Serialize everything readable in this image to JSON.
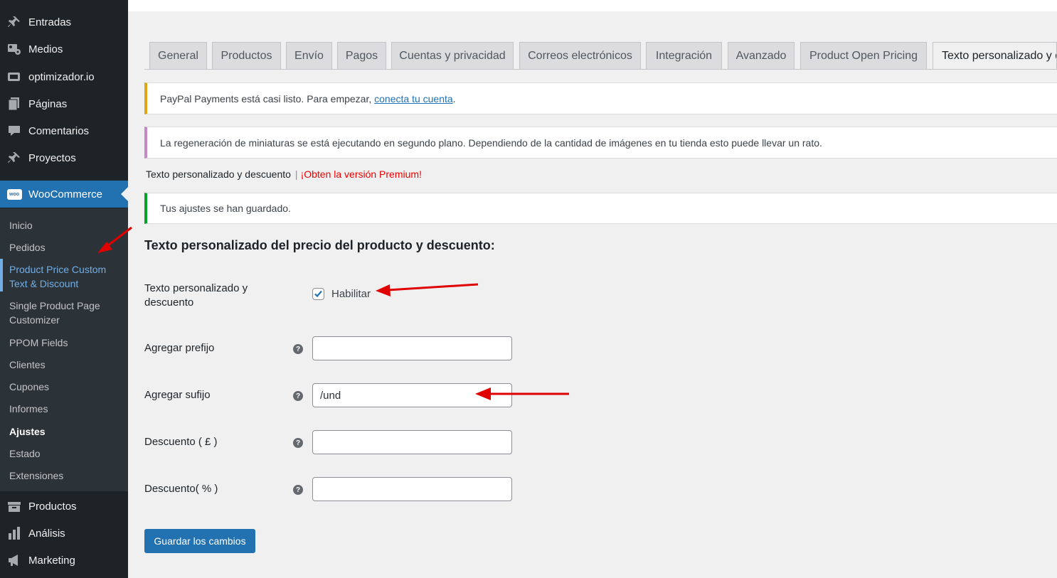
{
  "sidebar": {
    "menu_top": [
      {
        "label": "Entradas",
        "icon": "pin-icon"
      },
      {
        "label": "Medios",
        "icon": "media-icon"
      },
      {
        "label": "optimizador.io",
        "icon": "optimizer-icon"
      },
      {
        "label": "Páginas",
        "icon": "pages-icon"
      },
      {
        "label": "Comentarios",
        "icon": "comments-icon"
      },
      {
        "label": "Proyectos",
        "icon": "pin-icon"
      }
    ],
    "woocommerce": {
      "label": "WooCommerce",
      "icon": "woo-icon",
      "badge": "woo"
    },
    "submenu": [
      "Inicio",
      "Pedidos",
      "Product Price Custom Text & Discount",
      "Single Product Page Customizer",
      "PPOM Fields",
      "Clientes",
      "Cupones",
      "Informes",
      "Ajustes",
      "Estado",
      "Extensiones"
    ],
    "menu_bottom": [
      {
        "label": "Productos",
        "icon": "products-icon"
      },
      {
        "label": "Análisis",
        "icon": "analytics-icon"
      },
      {
        "label": "Marketing",
        "icon": "megaphone-icon"
      }
    ]
  },
  "tabs": [
    "General",
    "Productos",
    "Envío",
    "Pagos",
    "Cuentas y privacidad",
    "Correos electrónicos",
    "Integración",
    "Avanzado",
    "Product Open Pricing",
    "Texto personalizado y descuento"
  ],
  "notices": {
    "paypal_text": "PayPal Payments está casi listo. Para empezar,",
    "paypal_link": "conecta tu cuenta",
    "paypal_end": ".",
    "regen_text": "La regeneración de miniaturas se está ejecutando en segundo plano. Dependiendo de la cantidad de imágenes en tu tienda esto puede llevar un rato.",
    "saved_text": "Tus ajustes se han guardado."
  },
  "plugin_heading": {
    "title": "Texto personalizado y descuento",
    "separator": "|",
    "premium": "¡Obten la versión Premium!"
  },
  "form": {
    "section_title": "Texto personalizado del precio del producto y descuento:",
    "enable_label": "Texto personalizado y descuento",
    "enable_checkbox_label": "Habilitar",
    "enable_checked": true,
    "prefix_label": "Agregar prefijo",
    "prefix_value": "",
    "suffix_label": "Agregar sufijo",
    "suffix_value": "/und",
    "discount_amount_label": "Descuento ( £ )",
    "discount_amount_value": "",
    "discount_percent_label": "Descuento( % )",
    "discount_percent_value": "",
    "help_glyph": "?",
    "save_label": "Guardar los cambios"
  },
  "colors": {
    "sidebar_bg": "#1d2327",
    "submenu_bg": "#2c3338",
    "accent": "#2271b1",
    "notice_warning": "#dba617",
    "notice_info": "#c589c7",
    "notice_success": "#00a32a",
    "premium_red": "#e00000",
    "annotation_arrow": "#e00000"
  }
}
